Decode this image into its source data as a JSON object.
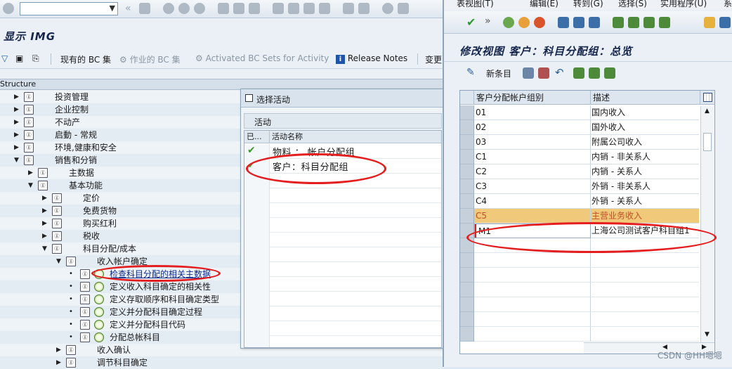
{
  "main": {
    "title": "显示 IMG",
    "app_toolbar": {
      "bc_sets": "现有的 BC 集",
      "bc_sets_activity": "作业的 BC 集",
      "activated_bc_sets": "Activated BC Sets for Activity",
      "release_notes": "Release Notes",
      "change": "变更"
    },
    "tree_header": "Structure",
    "tree": [
      {
        "label": "投资管理"
      },
      {
        "label": "企业控制"
      },
      {
        "label": "不动产"
      },
      {
        "label": "启動 - 常规"
      },
      {
        "label": "环境,健康和安全"
      },
      {
        "label": "销售和分销"
      },
      {
        "label": "主数据"
      },
      {
        "label": "基本功能"
      },
      {
        "label": "定价"
      },
      {
        "label": "免费货物"
      },
      {
        "label": "购买红利"
      },
      {
        "label": "税收"
      },
      {
        "label": "科目分配/成本"
      },
      {
        "label": "收入帐户确定"
      },
      {
        "label": "检查科目分配的相关主数据"
      },
      {
        "label": "定义收入科目确定的相关性"
      },
      {
        "label": "定义存取顺序和科目确定类型"
      },
      {
        "label": "定义并分配科目确定过程"
      },
      {
        "label": "定义并分配科目代码"
      },
      {
        "label": "分配总帐科目"
      },
      {
        "label": "收入确认"
      },
      {
        "label": "调节科目确定"
      }
    ]
  },
  "popup": {
    "title": "选择活动",
    "group_label": "活动",
    "col_done": "已...",
    "col_name": "活动名称",
    "rows": [
      {
        "name": "物料 ： 帐户分配组"
      },
      {
        "name": "客户：科目分配组"
      }
    ]
  },
  "right": {
    "menu": [
      "表视图(T)",
      "编辑(E)",
      "转到(G)",
      "选择(S)",
      "实用程序(U)",
      "系"
    ],
    "title": "修改视图 客户：科目分配组：总览",
    "new_entries": "新条目",
    "col_code": "客户分配帐户组别",
    "col_desc": "描述",
    "rows": [
      {
        "code": "01",
        "desc": "国内收入"
      },
      {
        "code": "02",
        "desc": "国外收入"
      },
      {
        "code": "03",
        "desc": "附属公司收入"
      },
      {
        "code": "C1",
        "desc": "内销 - 非关系人"
      },
      {
        "code": "C2",
        "desc": "内销 - 关系人"
      },
      {
        "code": "C3",
        "desc": "外销 - 非关系人"
      },
      {
        "code": "C4",
        "desc": "外销 - 关系人"
      },
      {
        "code": "C5",
        "desc": "主营业务收入"
      },
      {
        "code": "M1",
        "desc": "上海公司测试客户科目组1"
      }
    ]
  },
  "watermark": "CSDN @HH嗯嗯",
  "colors": {
    "accent": "#15254a",
    "highlight": "#f0c97a",
    "annotation": "#e41e1e",
    "check": "#3a9a2a"
  }
}
